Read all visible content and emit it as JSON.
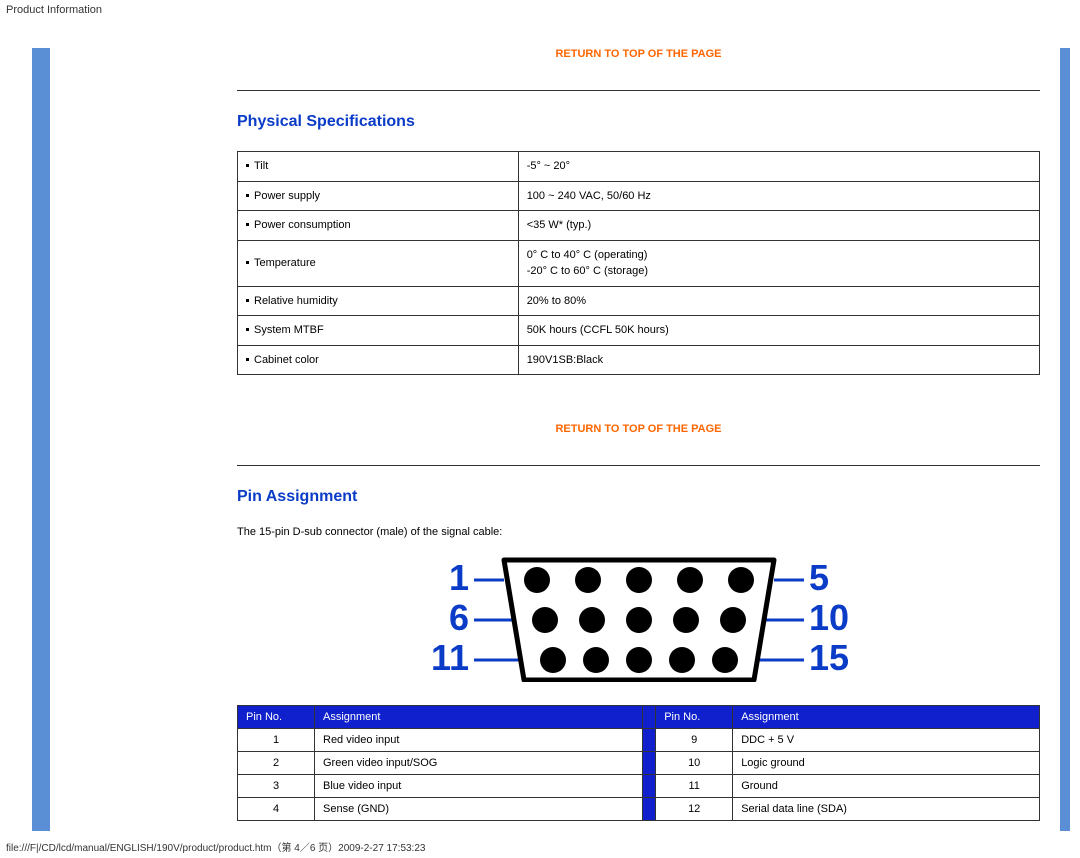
{
  "header": {
    "title": "Product Information"
  },
  "links": {
    "return_top": "RETURN TO TOP OF THE PAGE"
  },
  "physical": {
    "heading": "Physical Specifications",
    "rows": [
      {
        "label": "Tilt",
        "value": "-5° ~ 20°"
      },
      {
        "label": "Power supply",
        "value": "100 ~ 240 VAC, 50/60 Hz"
      },
      {
        "label": "Power consumption",
        "value": "<35 W* (typ.)"
      },
      {
        "label": "Temperature",
        "value": "0° C to 40° C (operating)\n-20° C to 60° C (storage)"
      },
      {
        "label": "Relative humidity",
        "value": "20% to 80%"
      },
      {
        "label": "System MTBF",
        "value": "50K hours (CCFL 50K hours)"
      },
      {
        "label": "Cabinet color",
        "value": "190V1SB:Black"
      }
    ]
  },
  "pin_section": {
    "heading": "Pin Assignment",
    "intro": "The 15-pin D-sub connector (male) of the signal cable:",
    "connector_labels": {
      "l1": "1",
      "l2": "6",
      "l3": "11",
      "r1": "5",
      "r2": "10",
      "r3": "15"
    },
    "columns": {
      "pinno": "Pin No.",
      "assign": "Assignment"
    },
    "left": [
      {
        "no": "1",
        "assign": "Red video input"
      },
      {
        "no": "2",
        "assign": "Green video input/SOG"
      },
      {
        "no": "3",
        "assign": "Blue video input"
      },
      {
        "no": "4",
        "assign": "Sense (GND)"
      }
    ],
    "right": [
      {
        "no": "9",
        "assign": "DDC + 5 V"
      },
      {
        "no": "10",
        "assign": "Logic ground"
      },
      {
        "no": "11",
        "assign": "Ground"
      },
      {
        "no": "12",
        "assign": "Serial data line (SDA)"
      }
    ]
  },
  "footer": {
    "text": "file:///F|/CD/lcd/manual/ENGLISH/190V/product/product.htm（第 4／6 页）2009-2-27 17:53:23"
  }
}
